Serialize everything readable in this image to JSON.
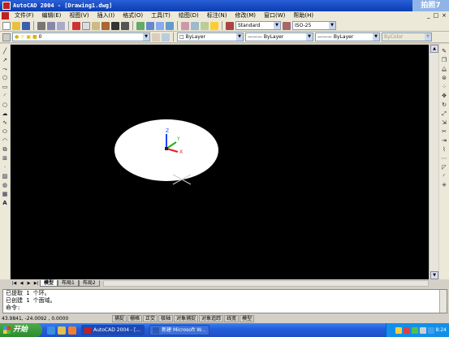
{
  "window": {
    "title": "AutoCAD 2004 - [Drawing1.dwg]",
    "badge": "拍照7",
    "controls": [
      "_",
      "□",
      "×"
    ]
  },
  "menu": {
    "items": [
      "文件(F)",
      "编辑(E)",
      "视图(V)",
      "插入(I)",
      "格式(O)",
      "工具(T)",
      "绘图(D)",
      "标注(N)",
      "修改(M)",
      "窗口(W)",
      "帮助(H)"
    ],
    "mdi_controls": [
      "_",
      "□",
      "×"
    ]
  },
  "toolbar": {
    "text_style": "Standard",
    "dim_style": "ISO-25",
    "layer": "0",
    "color": "ByLayer",
    "linetype": "ByLayer",
    "lineweight": "ByLayer",
    "plotstyle": "ByColor"
  },
  "tabs": [
    "模型",
    "布局1",
    "布局2"
  ],
  "command": {
    "lines": [
      "已提取 1 个环。",
      "已创建 1 个面域。",
      "命令:"
    ]
  },
  "status": {
    "coords": "43.9841,  -24.0092 , 0.0000",
    "buttons": [
      "捕捉",
      "栅格",
      "正交",
      "极轴",
      "对象捕捉",
      "对象追踪",
      "线宽",
      "模型"
    ]
  },
  "taskbar": {
    "start_label": "开始",
    "tasks": [
      "AutoCAD 2004 - [...",
      "新建 Microsoft W..."
    ],
    "clock": "8:24"
  },
  "ucs": {
    "x_label": "X",
    "y_label": "Y",
    "z_label": "Z"
  },
  "colors": {
    "canvas": "#000000",
    "region_fill": "#ffffff",
    "titlebar": "#0b3db0",
    "taskbar": "#245edb",
    "start": "#2e8a2e"
  }
}
